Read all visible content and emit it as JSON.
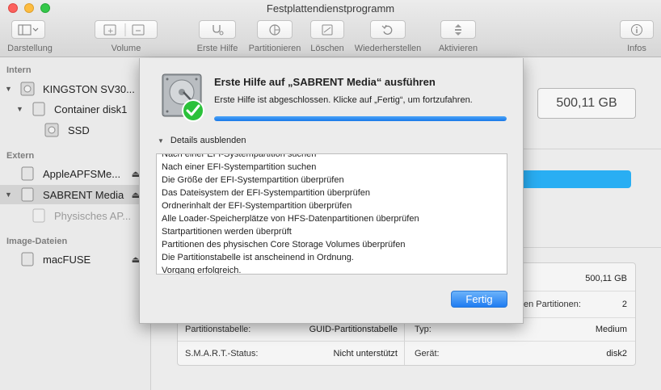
{
  "window": {
    "title": "Festplattendienstprogramm"
  },
  "toolbar": {
    "darstellung": "Darstellung",
    "volume": "Volume",
    "erste_hilfe": "Erste Hilfe",
    "partitionieren": "Partitionieren",
    "loeschen": "Löschen",
    "wiederherstellen": "Wiederherstellen",
    "aktivieren": "Aktivieren",
    "infos": "Infos"
  },
  "sidebar": {
    "sections": [
      "Intern",
      "Extern",
      "Image-Dateien"
    ],
    "items": [
      {
        "label": "KINGSTON SV30..."
      },
      {
        "label": "Container disk1"
      },
      {
        "label": "SSD"
      },
      {
        "label": "AppleAPFSMe..."
      },
      {
        "label": "SABRENT Media"
      },
      {
        "label": "Physisches AP..."
      },
      {
        "label": "macFUSE"
      }
    ]
  },
  "main": {
    "capacity": "500,11 GB",
    "info": {
      "capacity_value": "500,11 GB",
      "partitions_label": "en Partitionen:",
      "partitions_value": "2",
      "partition_table_label": "Partitionstabelle:",
      "partition_table_value": "GUID-Partitionstabelle",
      "type_label": "Typ:",
      "type_value": "Medium",
      "smart_label": "S.M.A.R.T.-Status:",
      "smart_value": "Nicht unterstützt",
      "device_label": "Gerät:",
      "device_value": "disk2"
    }
  },
  "dialog": {
    "title": "Erste Hilfe auf „SABRENT Media“ ausführen",
    "message": "Erste Hilfe ist abgeschlossen. Klicke auf „Fertig“, um fortzufahren.",
    "progress": 1.0,
    "details_toggle": "Details ausblenden",
    "log": [
      "Nach einer EFI-Systempartition suchen",
      "Nach einer EFI-Systempartition suchen",
      "Die Größe der EFI-Systempartition überprüfen",
      "Das Dateisystem der EFI-Systempartition überprüfen",
      "Ordnerinhalt der EFI-Systempartition überprüfen",
      "Alle Loader-Speicherplätze von HFS-Datenpartitionen überprüfen",
      "Startpartitionen werden überprüft",
      "Partitionen des physischen Core Storage Volumes überprüfen",
      "Die Partitionstabelle ist anscheinend in Ordnung.",
      "Vorgang erfolgreich."
    ],
    "done_button": "Fertig"
  },
  "colors": {
    "accent": "#1f7cf1",
    "usage_bar": "#29aef3",
    "success": "#2bc13a"
  }
}
